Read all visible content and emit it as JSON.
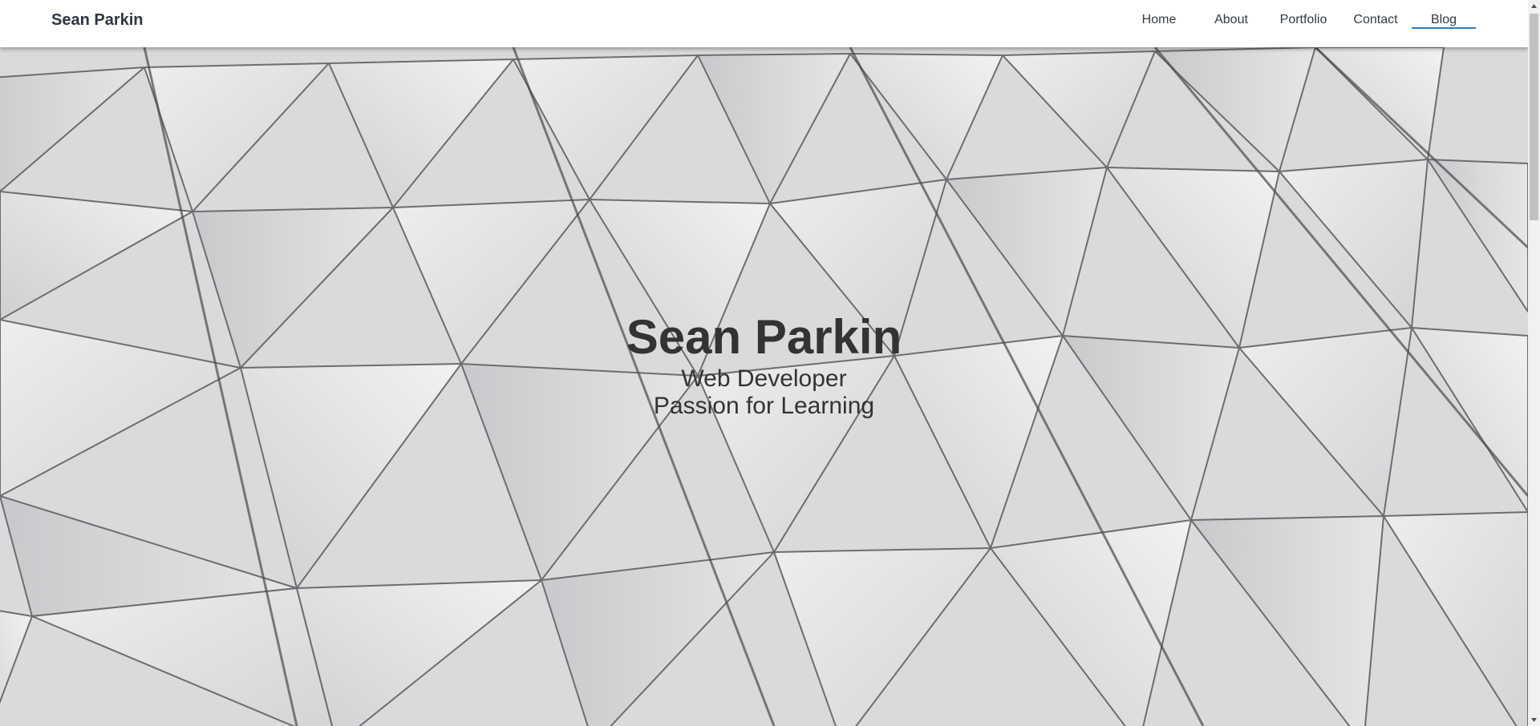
{
  "navbar": {
    "brand": "Sean Parkin",
    "items": [
      {
        "label": "Home",
        "active": false
      },
      {
        "label": "About",
        "active": false
      },
      {
        "label": "Portfolio",
        "active": false
      },
      {
        "label": "Contact",
        "active": false
      },
      {
        "label": "Blog",
        "active": true
      }
    ],
    "active_underline_color": "#2a7fc0"
  },
  "hero": {
    "title": "Sean Parkin",
    "subtitle_line1": "Web Developer",
    "subtitle_line2": "Passion for Learning",
    "background": "geometric-triangle-panel-facade"
  },
  "colors": {
    "text": "#333333",
    "brand": "#2e3545",
    "navbar_bg": "#ffffff"
  },
  "icons": {
    "scroll_up": "scroll-up-arrow-icon",
    "scroll_down": "scroll-down-arrow-icon"
  }
}
